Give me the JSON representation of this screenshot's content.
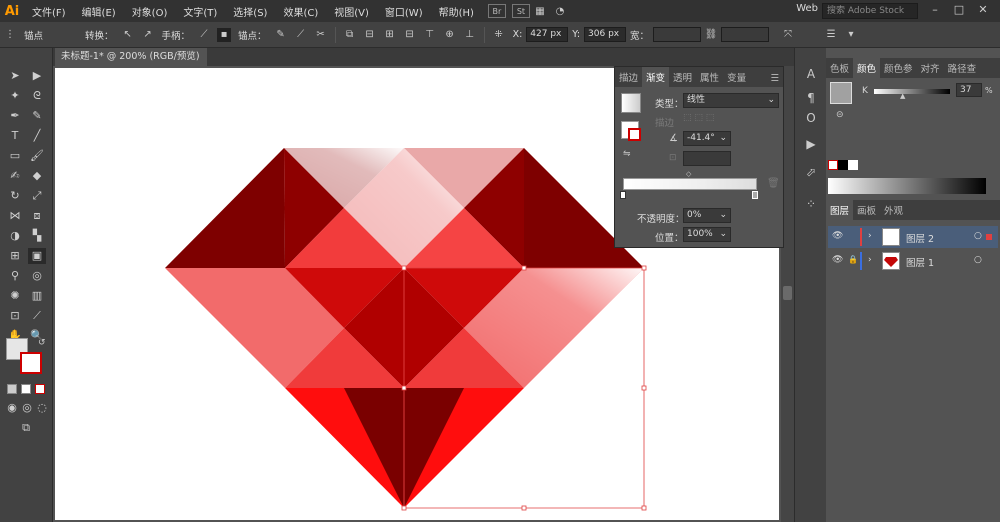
{
  "menubar": {
    "logo": "Ai",
    "items": [
      "文件(F)",
      "编辑(E)",
      "对象(O)",
      "文字(T)",
      "选择(S)",
      "效果(C)",
      "视图(V)",
      "窗口(W)",
      "帮助(H)"
    ],
    "icons": [
      "Br",
      "St"
    ],
    "workspace": "Web",
    "search_placeholder": "搜索 Adobe Stock"
  },
  "controlbar": {
    "anchor_label": "锚点",
    "convert_label": "转换：",
    "handle_label": "手柄：",
    "anchor2_label": "锚点：",
    "x_label": "X:",
    "x_value": "427 px",
    "y_label": "Y:",
    "y_value": "306 px",
    "w_label": "宽："
  },
  "document": {
    "tab_title": "未标题-1* @ 200% (RGB/预览)",
    "close": "×"
  },
  "gradient_panel": {
    "tabs": [
      "描边",
      "渐变",
      "透明",
      "属性",
      "变量"
    ],
    "active_tab": "渐变",
    "type_label": "类型：",
    "type_value": "线性",
    "stroke_label": "描边",
    "angle_value": "-41.4°",
    "opacity_label": "不透明度：",
    "opacity_value": "0%",
    "position_label": "位置：",
    "position_value": "100%"
  },
  "color_panel": {
    "tabs": [
      "色板",
      "颜色",
      "颜色参",
      "对齐",
      "路径查"
    ],
    "active_tab": "颜色",
    "channel_label": "K",
    "k_value": "37",
    "unit": "%"
  },
  "layers_panel": {
    "tabs": [
      "图层",
      "画板",
      "外观"
    ],
    "active_tab": "图层",
    "layers": [
      {
        "name": "图层 2",
        "color": "#e04040",
        "selected": true
      },
      {
        "name": "图层 1",
        "color": "#3a6ee0",
        "selected": false
      }
    ]
  },
  "colors": {
    "accent": "#ff9a00",
    "gem_dark": "#7a0000",
    "gem_mid": "#c40808",
    "gem_light": "#f56c6c",
    "selection": "#e04040"
  }
}
